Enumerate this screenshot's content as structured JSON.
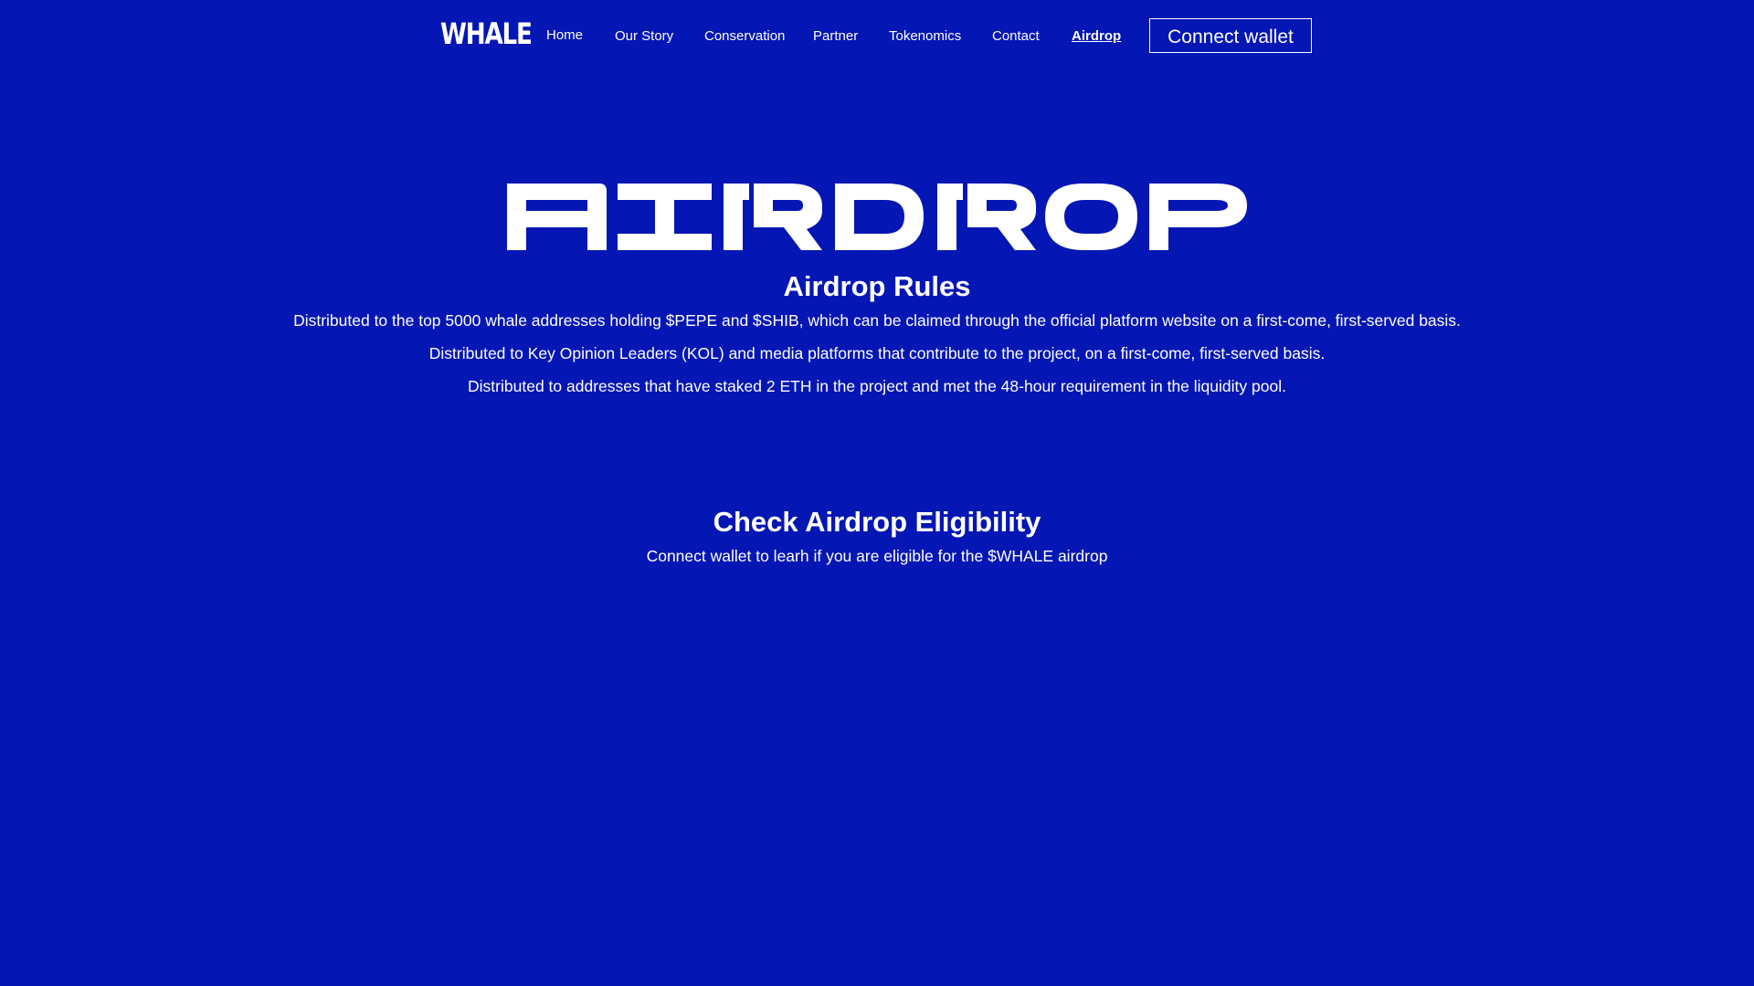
{
  "nav": {
    "logo": "WHALE",
    "links": [
      {
        "label": "Home"
      },
      {
        "label": "Our Story"
      },
      {
        "label": "Conservation"
      },
      {
        "label": "Partner"
      },
      {
        "label": "Tokenomics"
      },
      {
        "label": "Contact"
      },
      {
        "label": "Airdrop",
        "active": true
      }
    ],
    "connect_label": "Connect wallet"
  },
  "hero": {
    "word": "AIRDROP"
  },
  "rules": {
    "title": "Airdrop Rules",
    "items": [
      "Distributed to the top 5000 whale addresses holding $PEPE and $SHIB, which can be claimed through the official platform website on a first-come, first-served basis.",
      "Distributed to Key Opinion Leaders (KOL) and media platforms that contribute to the project, on a first-come, first-served basis.",
      "Distributed to addresses that have staked 2 ETH in the project and met the 48-hour requirement in the liquidity pool."
    ]
  },
  "eligibility": {
    "title": "Check Airdrop Eligibility",
    "subtitle": "Connect wallet to learh if you are eligible for the $WHALE airdrop"
  },
  "colors": {
    "background": "#0416b4",
    "text": "#ffffff"
  }
}
